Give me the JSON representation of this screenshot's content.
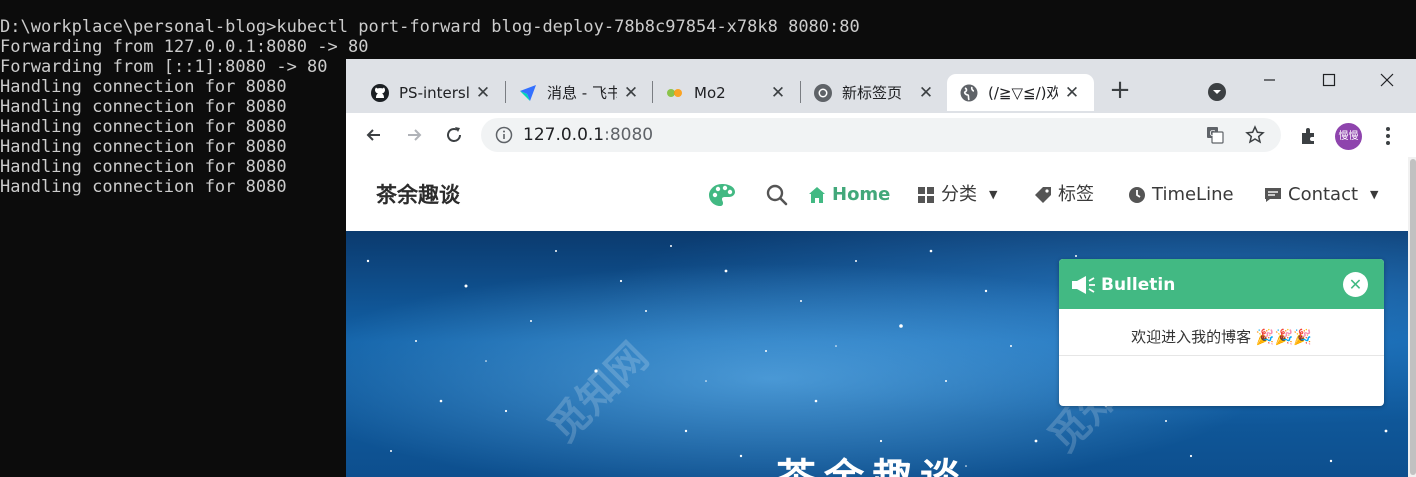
{
  "terminal": {
    "lines": [
      "D:\\workplace\\personal-blog>kubectl port-forward blog-deploy-78b8c97854-x78k8 8080:80",
      "Forwarding from 127.0.0.1:8080 -> 80",
      "Forwarding from [::1]:8080 -> 80",
      "Handling connection for 8080",
      "Handling connection for 8080",
      "Handling connection for 8080",
      "Handling connection for 8080",
      "Handling connection for 8080",
      "Handling connection for 8080"
    ]
  },
  "browser": {
    "tabs": [
      {
        "title": "PS-intersl",
        "icon": "github-icon"
      },
      {
        "title": "消息 - 飞书",
        "icon": "feishu-icon"
      },
      {
        "title": "Mo2",
        "icon": "mo2-icon"
      },
      {
        "title": "新标签页",
        "icon": "chrome-icon"
      },
      {
        "title": "(/≧▽≦/)欢",
        "icon": "globe-icon"
      }
    ],
    "url_host": "127.0.0.1",
    "url_port": ":8080",
    "avatar_text": "慢慢"
  },
  "site": {
    "brand": "茶余趣谈",
    "nav": {
      "home": "Home",
      "category": "分类",
      "tags": "标签",
      "timeline": "TimeLine",
      "contact": "Contact"
    },
    "hero_title": "茶余趣谈",
    "watermark": "觅知网",
    "bulletin": {
      "title": "Bulletin",
      "message": "欢迎进入我的博客 🎉🎉🎉"
    }
  },
  "colors": {
    "accent": "#42b983",
    "terminal_bg": "#0c0c0c",
    "terminal_fg": "#cccccc",
    "tabstrip": "#dee1e6"
  }
}
